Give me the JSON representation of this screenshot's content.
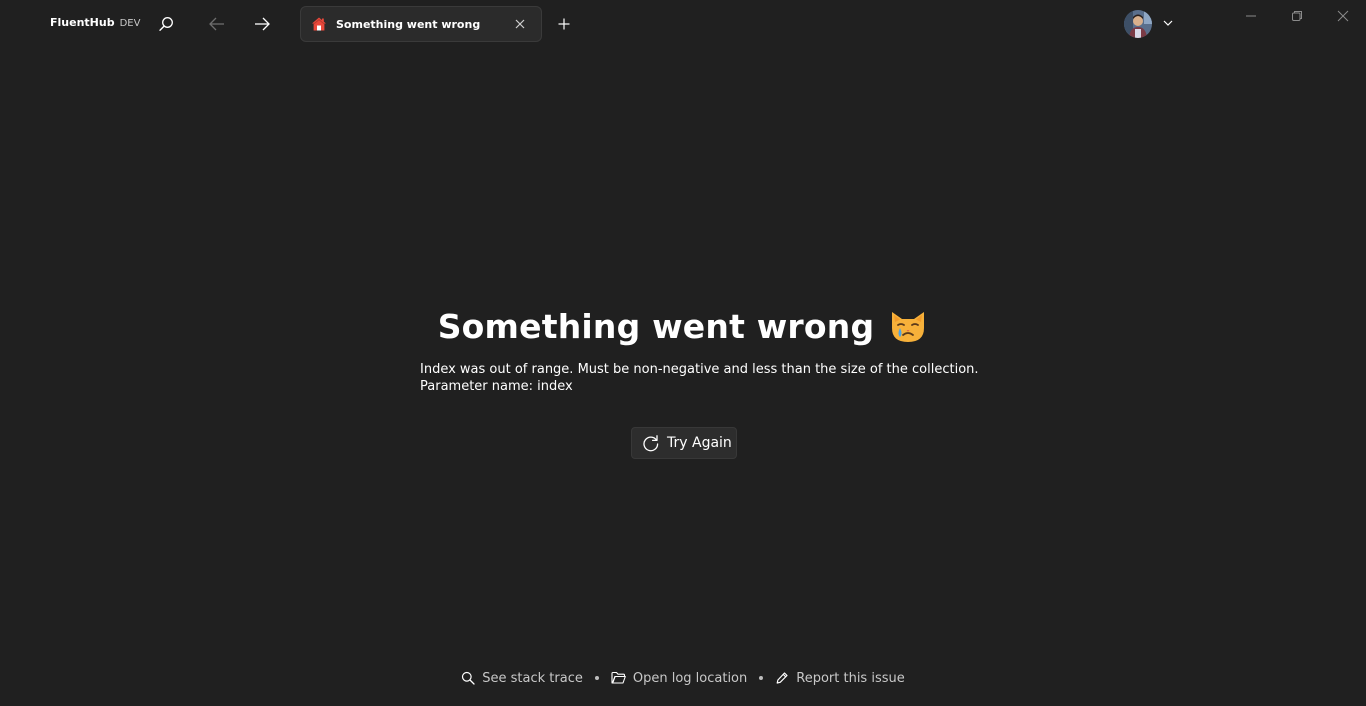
{
  "app": {
    "name": "FluentHub",
    "badge": "DEV"
  },
  "tab": {
    "title": "Something went wrong"
  },
  "error": {
    "title": "Something went wrong",
    "message_line1": "Index was out of range. Must be non-negative and less than the size of the collection.",
    "message_line2": "Parameter name: index"
  },
  "actions": {
    "try_again_label": "Try Again"
  },
  "footer": {
    "stack_trace_label": "See stack trace",
    "log_location_label": "Open log location",
    "report_issue_label": "Report this issue"
  },
  "colors": {
    "background": "#202020",
    "tab_background": "#2b2b2b",
    "button_background": "#2d2d2d",
    "text": "#ffffff",
    "muted_text": "#c8c8c8"
  },
  "icons": [
    "search-icon",
    "back-arrow-icon",
    "forward-arrow-icon",
    "home-icon",
    "close-icon",
    "add-icon",
    "avatar",
    "chevron-down-icon",
    "minimize-icon",
    "restore-icon",
    "window-close-icon",
    "crying-cat-emoji",
    "refresh-icon",
    "folder-icon",
    "bug-icon"
  ]
}
